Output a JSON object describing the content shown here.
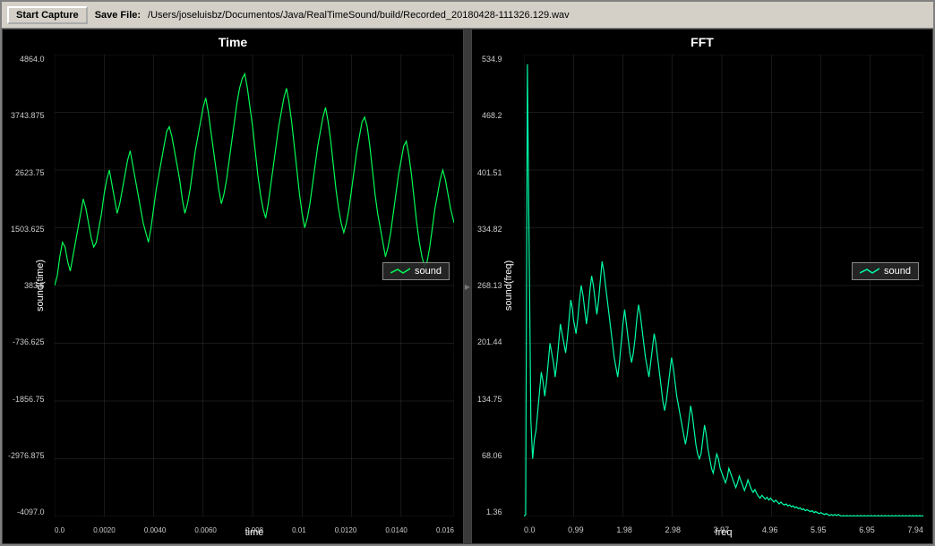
{
  "toolbar": {
    "start_capture_label": "Start Capture",
    "save_file_label": "Save File:",
    "save_file_path": "/Users/joseluisbz/Documentos/Java/RealTimeSound/build/Recorded_20180428-111326.129.wav"
  },
  "time_chart": {
    "title": "Time",
    "y_axis_label": "sound(time)",
    "x_axis_label": "time",
    "y_ticks": [
      "4864.0",
      "3743.875",
      "2623.75",
      "1503.625",
      "383.5",
      "-736.625",
      "-1856.75",
      "-2976.875",
      "-4097.0"
    ],
    "x_ticks": [
      "0.0",
      "0.0020",
      "0.0040",
      "0.0060",
      "0.008",
      "0.01",
      "0.0120",
      "0.0140",
      "0.016"
    ],
    "legend": "sound",
    "accent_color": "#00ff55"
  },
  "fft_chart": {
    "title": "FFT",
    "y_axis_label": "sound(freq)",
    "x_axis_label": "freq",
    "y_ticks": [
      "534.9",
      "468.2",
      "401.51",
      "334.82",
      "268.13",
      "201.44",
      "134.75",
      "68.06",
      "1.36"
    ],
    "x_ticks": [
      "0.0",
      "0.99",
      "1.98",
      "2.98",
      "3.97",
      "4.96",
      "5.95",
      "6.95",
      "7.94"
    ],
    "legend": "sound",
    "accent_color": "#00ffaa"
  }
}
